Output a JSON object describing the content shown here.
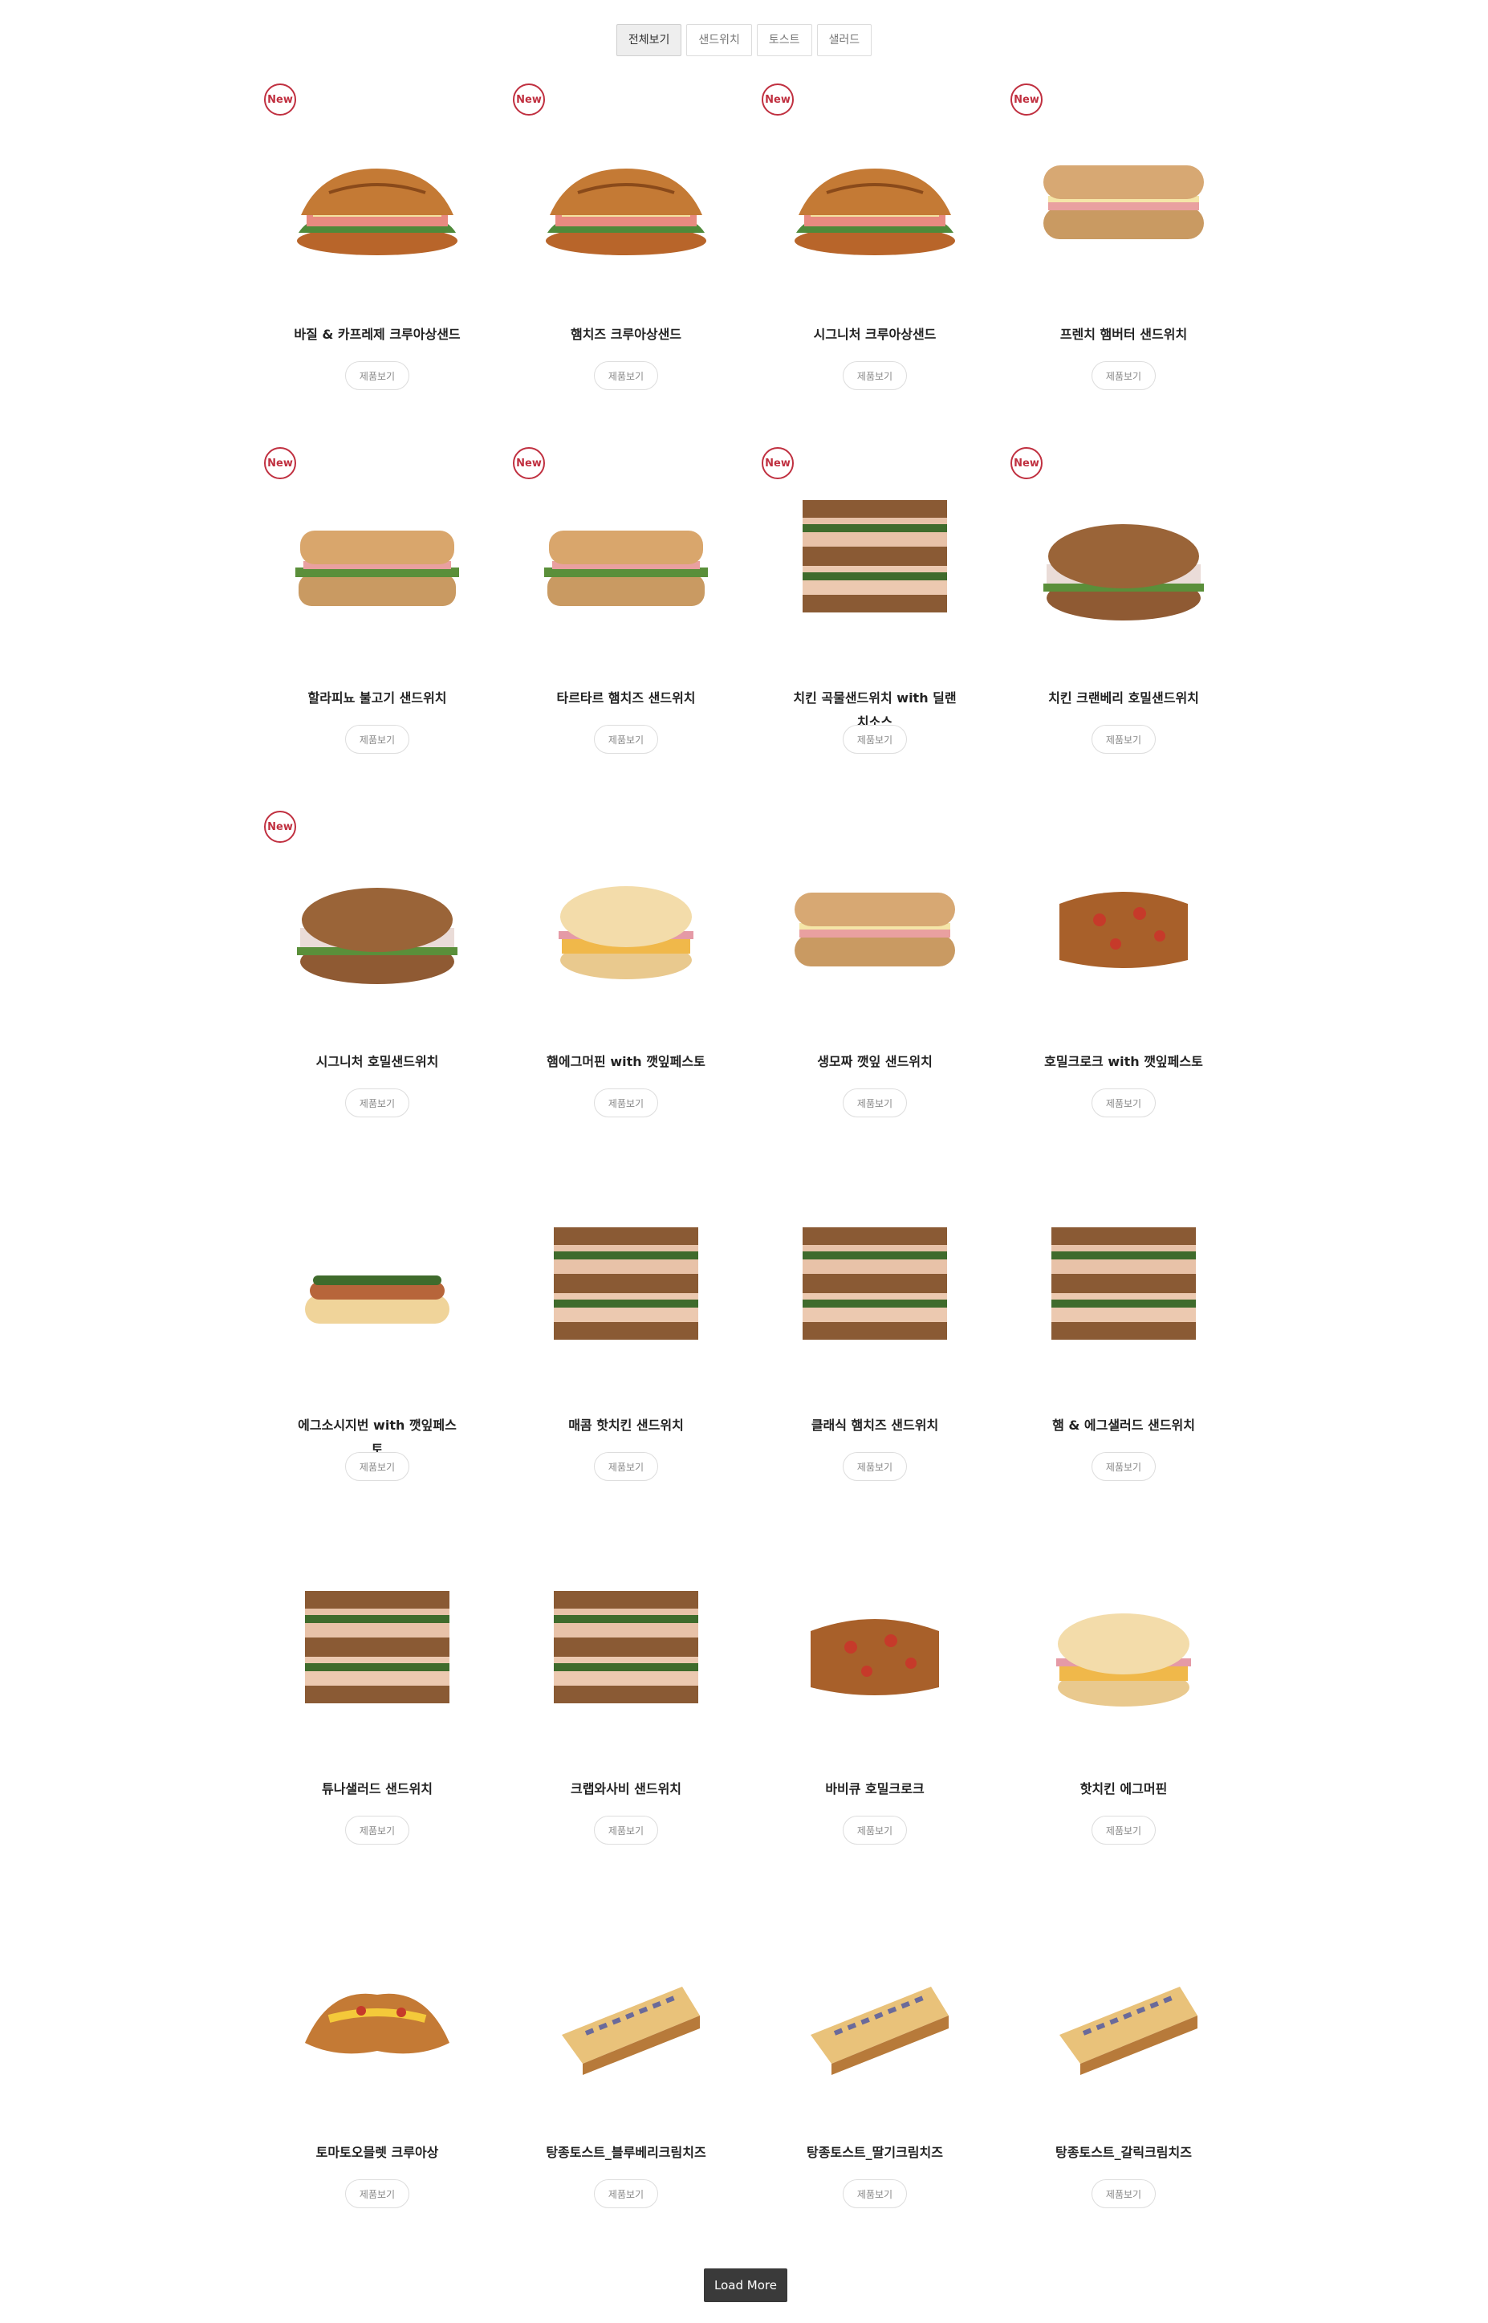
{
  "tabs": [
    "전체보기",
    "샌드위치",
    "토스트",
    "샐러드"
  ],
  "badge_text": "New",
  "detail_label": "제품보기",
  "load_more_label": "Load More",
  "products": [
    {
      "name": "바질 & 카프레제 크루아상샌드",
      "new": true,
      "img": "croissant-sandwich-icon"
    },
    {
      "name": "햄치즈 크루아상샌드",
      "new": true,
      "img": "croissant-sandwich-icon"
    },
    {
      "name": "시그니처 크루아상샌드",
      "new": true,
      "img": "croissant-sandwich-icon"
    },
    {
      "name": "프렌치 햄버터 샌드위치",
      "new": true,
      "img": "baguette-sandwich-icon"
    },
    {
      "name": "할라피뇨 불고기 샌드위치",
      "new": true,
      "img": "ciabatta-sandwich-icon"
    },
    {
      "name": "타르타르 햄치즈 샌드위치",
      "new": true,
      "img": "ciabatta-sandwich-icon"
    },
    {
      "name": "치킨 곡물샌드위치 with 딜랜치소스",
      "new": true,
      "img": "stacked-sandwich-icon"
    },
    {
      "name": "치킨 크랜베리 호밀샌드위치",
      "new": true,
      "img": "round-sandwich-icon"
    },
    {
      "name": "시그니처 호밀샌드위치",
      "new": true,
      "img": "round-sandwich-icon"
    },
    {
      "name": "햄에그머핀 with 깻잎페스토",
      "new": false,
      "img": "muffin-icon"
    },
    {
      "name": "생모짜 깻잎 샌드위치",
      "new": false,
      "img": "baguette-sandwich-icon"
    },
    {
      "name": "호밀크로크 with 깻잎페스토",
      "new": false,
      "img": "toast-icon"
    },
    {
      "name": "에그소시지번 with 깻잎페스토",
      "new": false,
      "img": "hotdog-bun-icon"
    },
    {
      "name": "매콤 핫치킨 샌드위치",
      "new": false,
      "img": "stacked-sandwich-icon"
    },
    {
      "name": "클래식 햄치즈 샌드위치",
      "new": false,
      "img": "stacked-sandwich-icon"
    },
    {
      "name": "햄 & 에그샐러드 샌드위치",
      "new": false,
      "img": "stacked-sandwich-icon"
    },
    {
      "name": "튜나샐러드 샌드위치",
      "new": false,
      "img": "stacked-sandwich-icon"
    },
    {
      "name": "크랩와사비 샌드위치",
      "new": false,
      "img": "stacked-sandwich-icon"
    },
    {
      "name": "바비큐 호밀크로크",
      "new": false,
      "img": "toast-icon"
    },
    {
      "name": "핫치킨 에그머핀",
      "new": false,
      "img": "muffin-icon"
    },
    {
      "name": "토마토오믈렛 크루아상",
      "new": false,
      "img": "croissant-icon"
    },
    {
      "name": "탕종토스트_블루베리크림치즈",
      "new": false,
      "img": "toast-slice-icon"
    },
    {
      "name": "탕종토스트_딸기크림치즈",
      "new": false,
      "img": "toast-slice-icon"
    },
    {
      "name": "탕종토스트_갈릭크림치즈",
      "new": false,
      "img": "toast-slice-icon"
    }
  ]
}
